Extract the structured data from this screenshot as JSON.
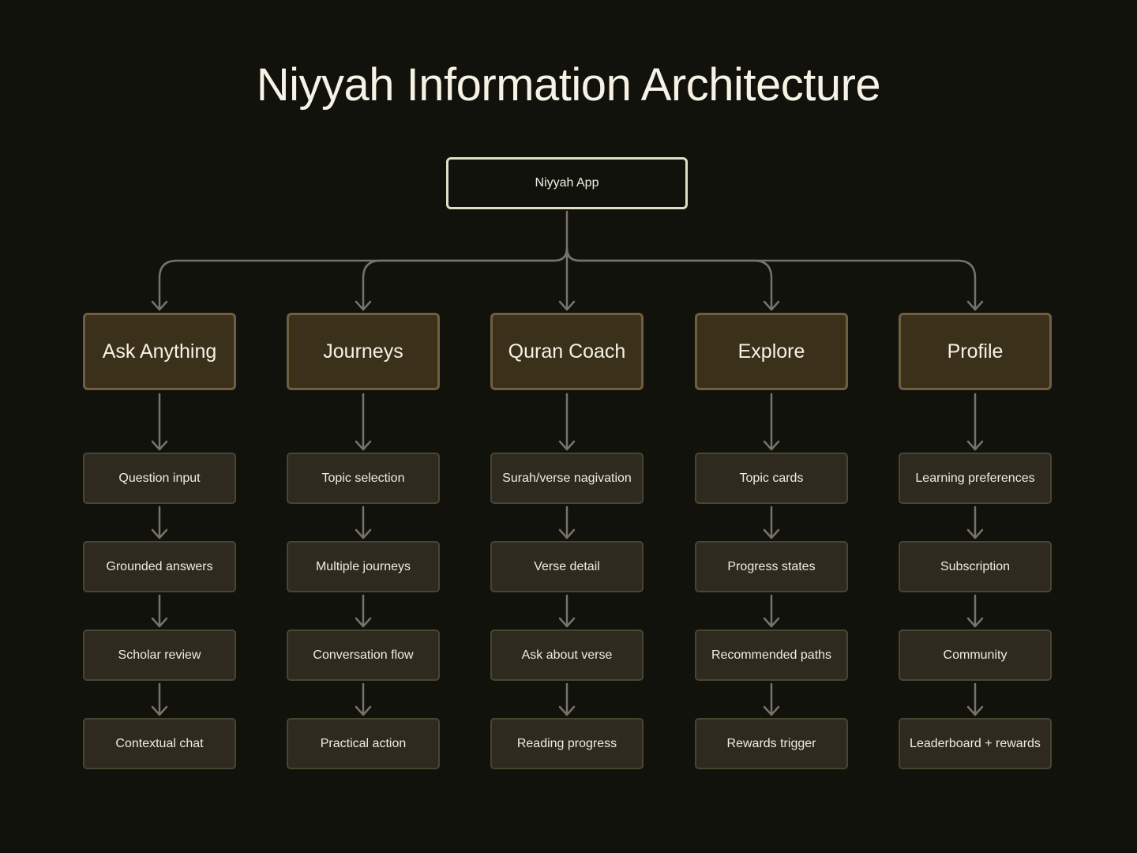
{
  "title": "Niyyah Information Architecture",
  "root": {
    "label": "Niyyah App"
  },
  "colors": {
    "background": "#11120b",
    "root_border": "#e2dccb",
    "section_fill": "#3b301a",
    "section_border": "#6e5f40",
    "item_fill": "#2e2a1f",
    "item_border": "#4a4433",
    "connector": "#76736a"
  },
  "sections": [
    {
      "label": "Ask Anything",
      "items": [
        "Question input",
        "Grounded answers",
        "Scholar review",
        "Contextual chat"
      ]
    },
    {
      "label": "Journeys",
      "items": [
        "Topic selection",
        "Multiple journeys",
        "Conversation flow",
        "Practical action"
      ]
    },
    {
      "label": "Quran Coach",
      "items": [
        "Surah/verse nagivation",
        "Verse detail",
        "Ask about verse",
        "Reading progress"
      ]
    },
    {
      "label": "Explore",
      "items": [
        "Topic cards",
        "Progress states",
        "Recommended paths",
        "Rewards trigger"
      ]
    },
    {
      "label": "Profile",
      "items": [
        "Learning preferences",
        "Subscription",
        "Community",
        "Leaderboard + rewards"
      ]
    }
  ]
}
